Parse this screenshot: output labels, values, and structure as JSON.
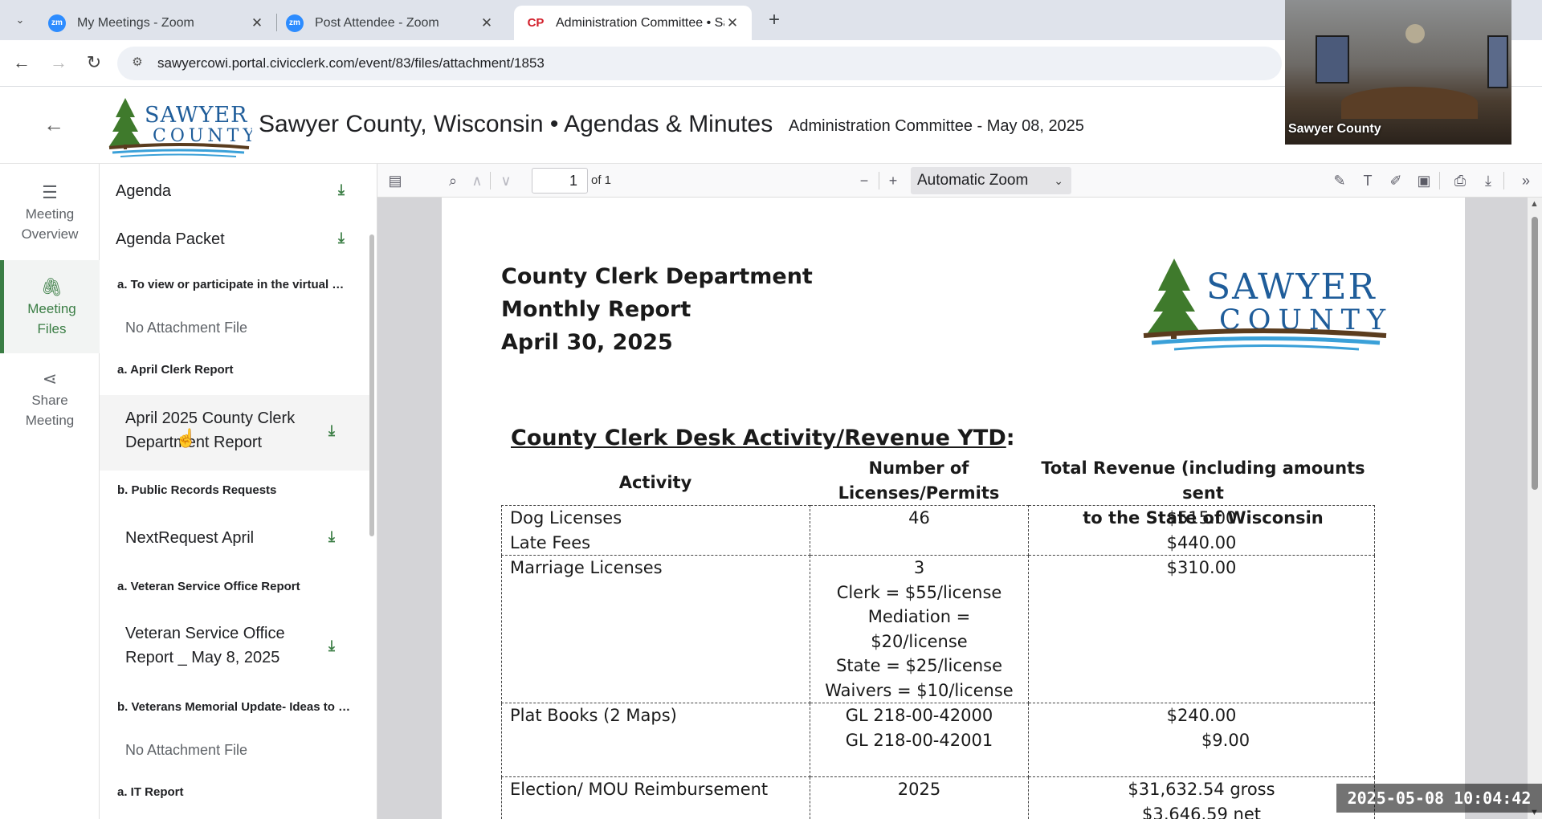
{
  "browser": {
    "tabs": [
      {
        "label": "My Meetings - Zoom",
        "icon": "zoom-icon"
      },
      {
        "label": "Post Attendee - Zoom",
        "icon": "zoom-icon"
      },
      {
        "label": "Administration Committee • Sa",
        "icon": "civicclerk-icon"
      }
    ],
    "favicon_zoom_text": "zm",
    "favicon_cc_text": "CP",
    "url": "sawyercowi.portal.civicclerk.com/event/83/files/attachment/1853"
  },
  "video": {
    "participant_name": "Sawyer County"
  },
  "header": {
    "logo_top": "SAWYER",
    "logo_bottom": "COUNTY",
    "site_title": "Sawyer County, Wisconsin • Agendas & Minutes",
    "meeting_title": "Administration Committee - May 08, 2025"
  },
  "rail": {
    "items": [
      {
        "label_1": "Meeting",
        "label_2": "Overview",
        "icon": "list-icon"
      },
      {
        "label_1": "Meeting",
        "label_2": "Files",
        "icon": "paperclip-icon"
      },
      {
        "label_1": "Share",
        "label_2": "Meeting",
        "icon": "share-icon"
      }
    ]
  },
  "files": {
    "agenda": "Agenda",
    "agenda_packet": "Agenda Packet",
    "sections": [
      {
        "heading": "a. To view or participate in the virtual …",
        "note": "No Attachment File"
      },
      {
        "heading": "a. April Clerk Report",
        "file_line_1": "April 2025 County Clerk",
        "file_line_2": "Department Report"
      },
      {
        "heading": "b. Public Records Requests",
        "file": "NextRequest April"
      },
      {
        "heading": "a. Veteran Service Office Report",
        "file_line_1": "Veteran Service Office",
        "file_line_2": "Report _ May 8, 2025"
      },
      {
        "heading": "b. Veterans Memorial Update- Ideas to …",
        "note": "No Attachment File"
      },
      {
        "heading": "a. IT Report"
      }
    ]
  },
  "pdf_toolbar": {
    "page_number": "1",
    "page_of": "of 1",
    "zoom": "Automatic Zoom"
  },
  "document": {
    "title_line_1": "County Clerk Department",
    "title_line_2": "Monthly Report",
    "title_line_3": "April 30, 2025",
    "heading": "County Clerk Desk Activity/Revenue YTD",
    "heading_suffix": ":",
    "col_activity": "Activity",
    "col_count_1": "Number of",
    "col_count_2": "Licenses/Permits",
    "col_revenue_1": "Total Revenue (including amounts sent",
    "col_revenue_2": "to the State of Wisconsin",
    "rows": [
      {
        "activity": [
          "Dog Licenses",
          "Late Fees"
        ],
        "count": [
          "46"
        ],
        "revenue": [
          "$515.00",
          "$440.00"
        ]
      },
      {
        "activity": [
          "Marriage Licenses"
        ],
        "count": [
          "3",
          "Clerk = $55/license",
          "Mediation = $20/license",
          "State = $25/license",
          "Waivers = $10/license"
        ],
        "revenue": [
          "$310.00"
        ]
      },
      {
        "activity": [
          "Plat Books (2 Maps)"
        ],
        "count": [
          "GL 218-00-42000",
          "GL 218-00-42001"
        ],
        "revenue": [
          "$240.00",
          "$9.00"
        ]
      },
      {
        "activity": [
          "Election/ MOU Reimbursement"
        ],
        "count": [
          "2025"
        ],
        "revenue": [
          "$31,632.54 gross",
          "$3,646.59 net"
        ]
      }
    ]
  },
  "timestamp": "2025-05-08  10:04:42",
  "colors": {
    "accent_green": "#3a7d44",
    "zoom_blue": "#2d8cff",
    "logo_blue": "#1f5d9a"
  }
}
